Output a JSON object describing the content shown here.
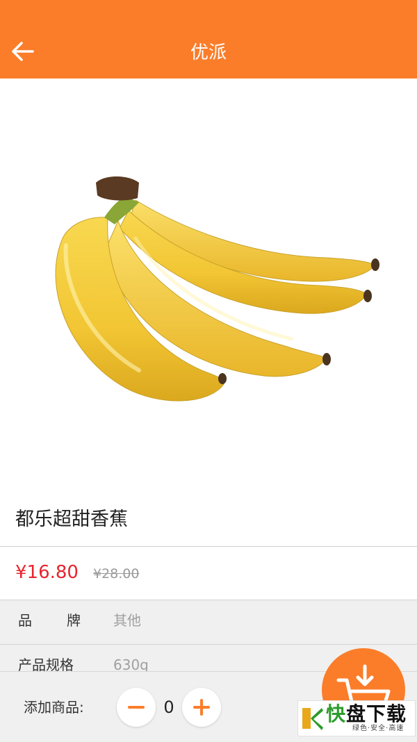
{
  "header": {
    "title": "优派",
    "back_icon": "arrow-left-icon",
    "background": "#fb7d2a"
  },
  "product": {
    "image": "banana-bunch-image",
    "name": "都乐超甜香蕉",
    "price": "¥16.80",
    "original_price": "¥28.00",
    "price_color": "#e8242d"
  },
  "specs": [
    {
      "label": "品牌",
      "value": "其他"
    },
    {
      "label": "产品规格",
      "value": "630g"
    }
  ],
  "cart": {
    "add_label": "添加商品:",
    "quantity": "0",
    "minus_icon": "minus-icon",
    "plus_icon": "plus-icon",
    "cart_icon": "cart-download-icon"
  },
  "watermark": {
    "main_1": "快",
    "main_2": "盘下载",
    "sub": "绿色·安全·高速"
  }
}
